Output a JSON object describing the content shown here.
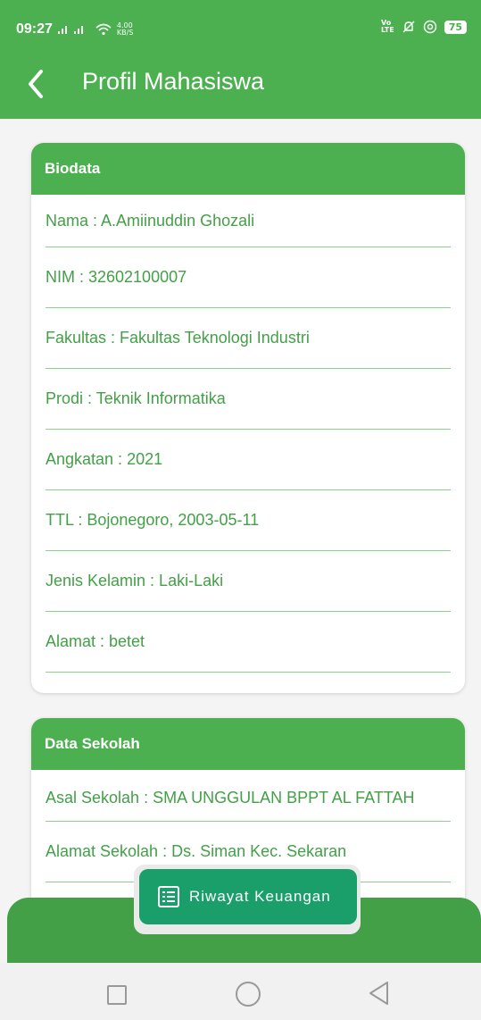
{
  "status_bar": {
    "time": "09:27",
    "net_speed_value": "4.00",
    "net_speed_unit": "KB/S",
    "network_label_top": "Vo",
    "network_label_bottom": "LTE",
    "battery": "75"
  },
  "app_bar": {
    "title": "Profil Mahasiswa"
  },
  "biodata": {
    "header": "Biodata",
    "rows": [
      "Nama : A.Amiinuddin Ghozali",
      "NIM : 32602100007",
      "Fakultas : Fakultas Teknologi Industri",
      "Prodi : Teknik Informatika",
      "Angkatan : 2021",
      "TTL : Bojonegoro, 2003-05-11",
      "Jenis Kelamin : Laki-Laki",
      "Alamat : betet"
    ]
  },
  "sekolah": {
    "header": "Data Sekolah",
    "rows": [
      "Asal Sekolah : SMA UNGGULAN BPPT AL FATTAH",
      "Alamat Sekolah : Ds. Siman Kec. Sekaran"
    ]
  },
  "fab": {
    "label": "Riwayat Keuangan",
    "icon": "list-icon"
  },
  "colors": {
    "primary": "#4caf50",
    "text_green": "#43a047",
    "fab_bg": "#1a9e6a"
  }
}
